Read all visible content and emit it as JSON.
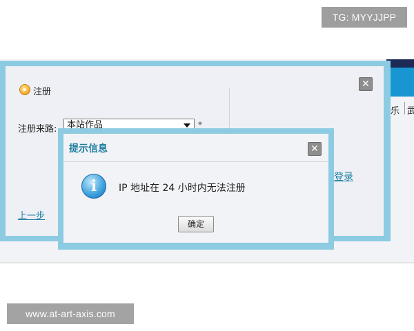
{
  "watermark": {
    "top": "TG: MYYJJPP",
    "bottom": "www.at-art-axis.com"
  },
  "background": {
    "nav_item_1": "乐",
    "nav_item_2": "武"
  },
  "register_dialog": {
    "title": "注册",
    "close_glyph": "✕",
    "source_label": "注册来路:",
    "source_selected": "本站作品",
    "required_mark": "*",
    "prev_link": "上一步",
    "login_link": "登录"
  },
  "alert_dialog": {
    "title": "提示信息",
    "close_glyph": "✕",
    "icon_glyph": "i",
    "message": "IP 地址在 24 小时内无法注册",
    "ok_button": "确定"
  },
  "colors": {
    "dialog_border": "#8ccbe1",
    "title_blue": "#1d7fa0",
    "header_navy": "#1c2a55",
    "header_blue": "#1896d2"
  }
}
